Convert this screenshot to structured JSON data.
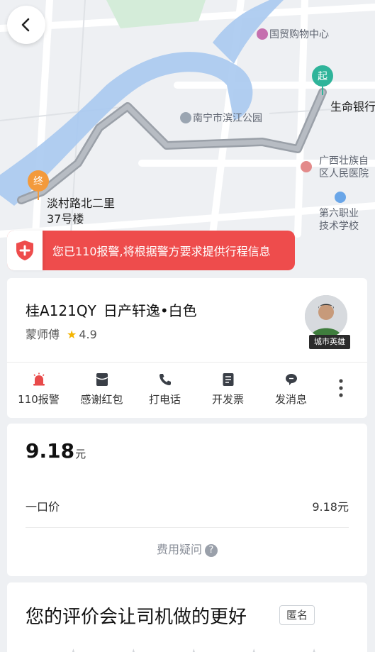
{
  "map": {
    "poi_shopping": "国贸购物中心",
    "poi_park": "南宁市滨江公园",
    "poi_bank": "生命银行",
    "poi_hospital_line1": "广西壮族自",
    "poi_hospital_line2": "区人民医院",
    "poi_school_line1": "第六职业",
    "poi_school_line2": "技术学校",
    "destination_line1": "淡村路北二里",
    "destination_line2": "37号楼",
    "start_pin": "起",
    "end_pin": "终"
  },
  "alert": {
    "text": "您已110报警,将根据警方要求提供行程信息",
    "color": "#ee4c4c"
  },
  "driver": {
    "plate": "桂A121QY",
    "car": "日产轩逸•白色",
    "name": "蒙师傅",
    "rating": "4.9",
    "badge": "城市英雄"
  },
  "actions": [
    {
      "label": "110报警",
      "icon": "alarm-icon"
    },
    {
      "label": "感谢红包",
      "icon": "red-packet-icon"
    },
    {
      "label": "打电话",
      "icon": "phone-icon"
    },
    {
      "label": "开发票",
      "icon": "invoice-icon"
    },
    {
      "label": "发消息",
      "icon": "message-icon"
    }
  ],
  "fare": {
    "amount": "9.18",
    "unit": "元",
    "row_label": "一口价",
    "row_value": "9.18元",
    "question": "费用疑问"
  },
  "rating": {
    "title": "您的评价会让司机做的更好",
    "anonymous": "匿名"
  }
}
